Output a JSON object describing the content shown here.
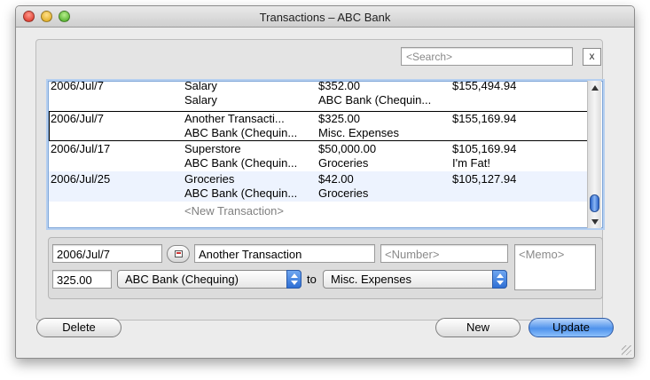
{
  "window": {
    "title": "Transactions – ABC Bank"
  },
  "search": {
    "placeholder": "<Search>",
    "clear_label": "x"
  },
  "transactions": [
    {
      "date": "2006/Jul/7",
      "name": "Salary",
      "amount": "$352.00",
      "balance": "$155,494.94",
      "account": "Salary",
      "category": "ABC Bank (Chequin...",
      "memo": ""
    },
    {
      "date": "2006/Jul/7",
      "name": "Another Transacti...",
      "amount": "$325.00",
      "balance": "$155,169.94",
      "account": "ABC Bank (Chequin...",
      "category": "Misc. Expenses",
      "memo": ""
    },
    {
      "date": "2006/Jul/17",
      "name": "Superstore",
      "amount": "$50,000.00",
      "balance": "$105,169.94",
      "account": "ABC Bank (Chequin...",
      "category": "Groceries",
      "memo": "I'm Fat!"
    },
    {
      "date": "2006/Jul/25",
      "name": "Groceries",
      "amount": "$42.00",
      "balance": "$105,127.94",
      "account": "ABC Bank (Chequin...",
      "category": "Groceries",
      "memo": ""
    }
  ],
  "new_transaction_label": "<New Transaction>",
  "editor": {
    "date": "2006/Jul/7",
    "description": "Another Transaction",
    "number_placeholder": "<Number>",
    "memo_placeholder": "<Memo>",
    "amount": "325.00",
    "from_account": "ABC Bank (Chequing)",
    "to_label": "to",
    "to_account": "Misc. Expenses"
  },
  "buttons": {
    "delete": "Delete",
    "new": "New",
    "update": "Update"
  },
  "colors": {
    "selection_accent": "#7fa6d8",
    "alt_row": "#edf3fe",
    "default_button": "#4f92ec"
  }
}
